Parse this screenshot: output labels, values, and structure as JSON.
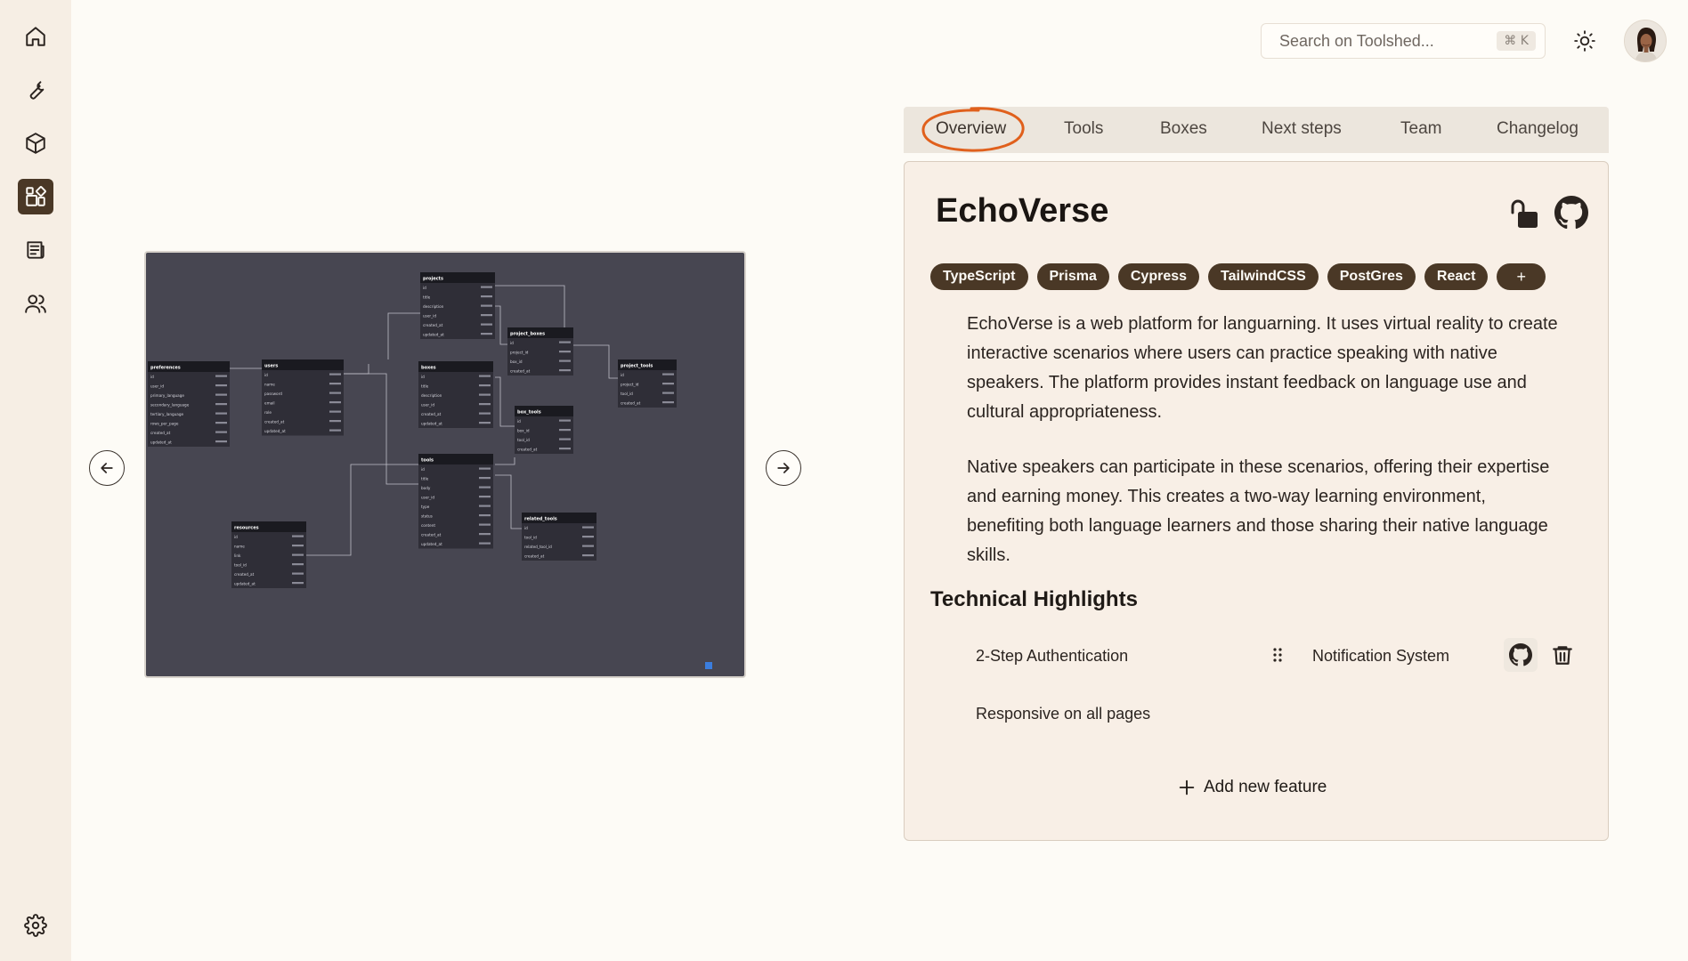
{
  "app": {
    "name": "Toolshed"
  },
  "search": {
    "placeholder": "Search on Toolshed...",
    "shortcut": "⌘ K"
  },
  "sidebar": {
    "items": [
      {
        "name": "home",
        "icon": "home-icon",
        "active": false
      },
      {
        "name": "tools",
        "icon": "wrench-icon",
        "active": false
      },
      {
        "name": "boxes",
        "icon": "cube-icon",
        "active": false
      },
      {
        "name": "projects",
        "icon": "projects-icon",
        "active": true
      },
      {
        "name": "docs",
        "icon": "newspaper-icon",
        "active": false
      },
      {
        "name": "team",
        "icon": "users-icon",
        "active": false
      }
    ],
    "footer_icon": "gear-icon"
  },
  "tabs": [
    "Overview",
    "Tools",
    "Boxes",
    "Next steps",
    "Team",
    "Changelog"
  ],
  "active_tab": "Overview",
  "project": {
    "title": "EchoVerse",
    "tags": [
      "TypeScript",
      "Prisma",
      "Cypress",
      "TailwindCSS",
      "PostGres",
      "React"
    ],
    "add_tag_label": "+",
    "description": [
      "EchoVerse is a web platform for languarning. It uses virtual reality to create interactive scenarios where users can practice speaking with native speakers. The platform provides instant feedback on language use and cultural appropriateness.",
      "Native speakers can participate in these scenarios, offering their expertise and earning money. This creates a two-way learning environment, benefiting both language learners and those sharing their native language skills."
    ],
    "highlights_title": "Technical Highlights",
    "features": [
      "2-Step Authentication",
      "Notification System",
      "Responsive on all pages"
    ],
    "add_feature_label": "Add new feature"
  },
  "colors": {
    "accent": "#4a3826",
    "highlight_circle": "#e0601c",
    "background": "#fdfbf6",
    "card": "#f8efe6"
  },
  "diagram": {
    "tables": [
      {
        "name": "projects",
        "rows": [
          "id",
          "title",
          "description",
          "user_id",
          "created_at",
          "updated_at"
        ]
      },
      {
        "name": "project_boxes",
        "rows": [
          "id",
          "project_id",
          "box_id",
          "created_at"
        ]
      },
      {
        "name": "project_tools",
        "rows": [
          "id",
          "project_id",
          "tool_id",
          "created_at"
        ]
      },
      {
        "name": "preferences",
        "rows": [
          "id",
          "user_id",
          "primary_language",
          "secondary_language",
          "tertiary_language",
          "rows_per_page",
          "created_at",
          "updated_at"
        ]
      },
      {
        "name": "users",
        "rows": [
          "id",
          "name",
          "password",
          "email",
          "role",
          "created_at",
          "updated_at"
        ]
      },
      {
        "name": "boxes",
        "rows": [
          "id",
          "title",
          "description",
          "user_id",
          "created_at",
          "updated_at"
        ]
      },
      {
        "name": "box_tools",
        "rows": [
          "id",
          "box_id",
          "tool_id",
          "created_at"
        ]
      },
      {
        "name": "tools",
        "rows": [
          "id",
          "title",
          "body",
          "user_id",
          "type",
          "status",
          "content",
          "created_at",
          "updated_at"
        ]
      },
      {
        "name": "related_tools",
        "rows": [
          "id",
          "tool_id",
          "related_tool_id",
          "created_at"
        ]
      },
      {
        "name": "resources",
        "rows": [
          "id",
          "name",
          "link",
          "tool_id",
          "created_at",
          "updated_at"
        ]
      }
    ]
  }
}
